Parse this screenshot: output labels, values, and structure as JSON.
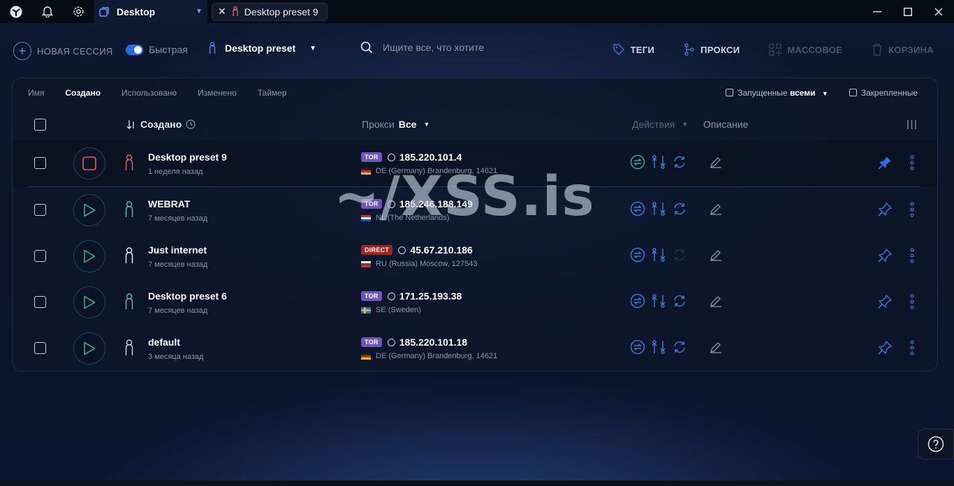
{
  "titlebar": {
    "tabs": [
      {
        "label": "Desktop",
        "active": true
      },
      {
        "label": "Desktop preset 9",
        "active": false
      }
    ]
  },
  "toolbar": {
    "new_session_label": "НОВАЯ СЕССИЯ",
    "quick_label": "Быстрая",
    "preset_label": "Desktop preset",
    "search_placeholder": "Ищите все, что хотите",
    "nav": {
      "tags": "ТЕГИ",
      "proxy": "ПРОКСИ",
      "bulk": "МАССОВОЕ",
      "trash": "КОРЗИНА"
    }
  },
  "filters": {
    "sort_tabs": [
      "Имя",
      "Создано",
      "Использовано",
      "Изменено",
      "Таймер"
    ],
    "active_index": 1,
    "running_label": "Запущенные",
    "running_scope": "всеми",
    "pinned_label": "Закрепленные"
  },
  "table": {
    "col_created": "Создано",
    "col_proxy": "Прокси",
    "col_proxy_filter": "Все",
    "col_actions": "Действия",
    "col_description": "Описание",
    "rows": [
      {
        "name": "Desktop preset 9",
        "ago": "1 неделя назад",
        "badge": "TOR",
        "ip": "185.220.101.4",
        "geo": "DE (Germany) Brandenburg, 14621",
        "running": true,
        "person_color": "#e0606a",
        "pinned": true
      },
      {
        "name": "WEBRAT",
        "ago": "7 месяцев назад",
        "badge": "TOR",
        "ip": "185.246.188.149",
        "geo": "NL (The Netherlands)",
        "running": false,
        "person_color": "#5fb89a",
        "pinned": false
      },
      {
        "name": "Just internet",
        "ago": "7 месяцев назад",
        "badge": "DIRECT",
        "ip": "45.67.210.186",
        "geo": "RU (Russia) Moscow, 127543",
        "running": false,
        "person_color": "#e4e8f0",
        "pinned": false
      },
      {
        "name": "Desktop preset 6",
        "ago": "7 месяцев назад",
        "badge": "TOR",
        "ip": "171.25.193.38",
        "geo": "SE (Sweden)",
        "running": false,
        "person_color": "#5fb89a",
        "pinned": false
      },
      {
        "name": "default",
        "ago": "3 месяца назад",
        "badge": "TOR",
        "ip": "185.220.101.18",
        "geo": "DE (Germany) Brandenburg, 14621",
        "running": false,
        "person_color": "#c7cdd9",
        "pinned": false
      }
    ]
  },
  "watermark": {
    "text": "~/XSS.is"
  },
  "colors": {
    "accent": "#2a6de0",
    "icon_blue": "#3b78d8",
    "tor": "#6f57b8",
    "direct": "#a3241f",
    "stop": "#e0606a"
  }
}
